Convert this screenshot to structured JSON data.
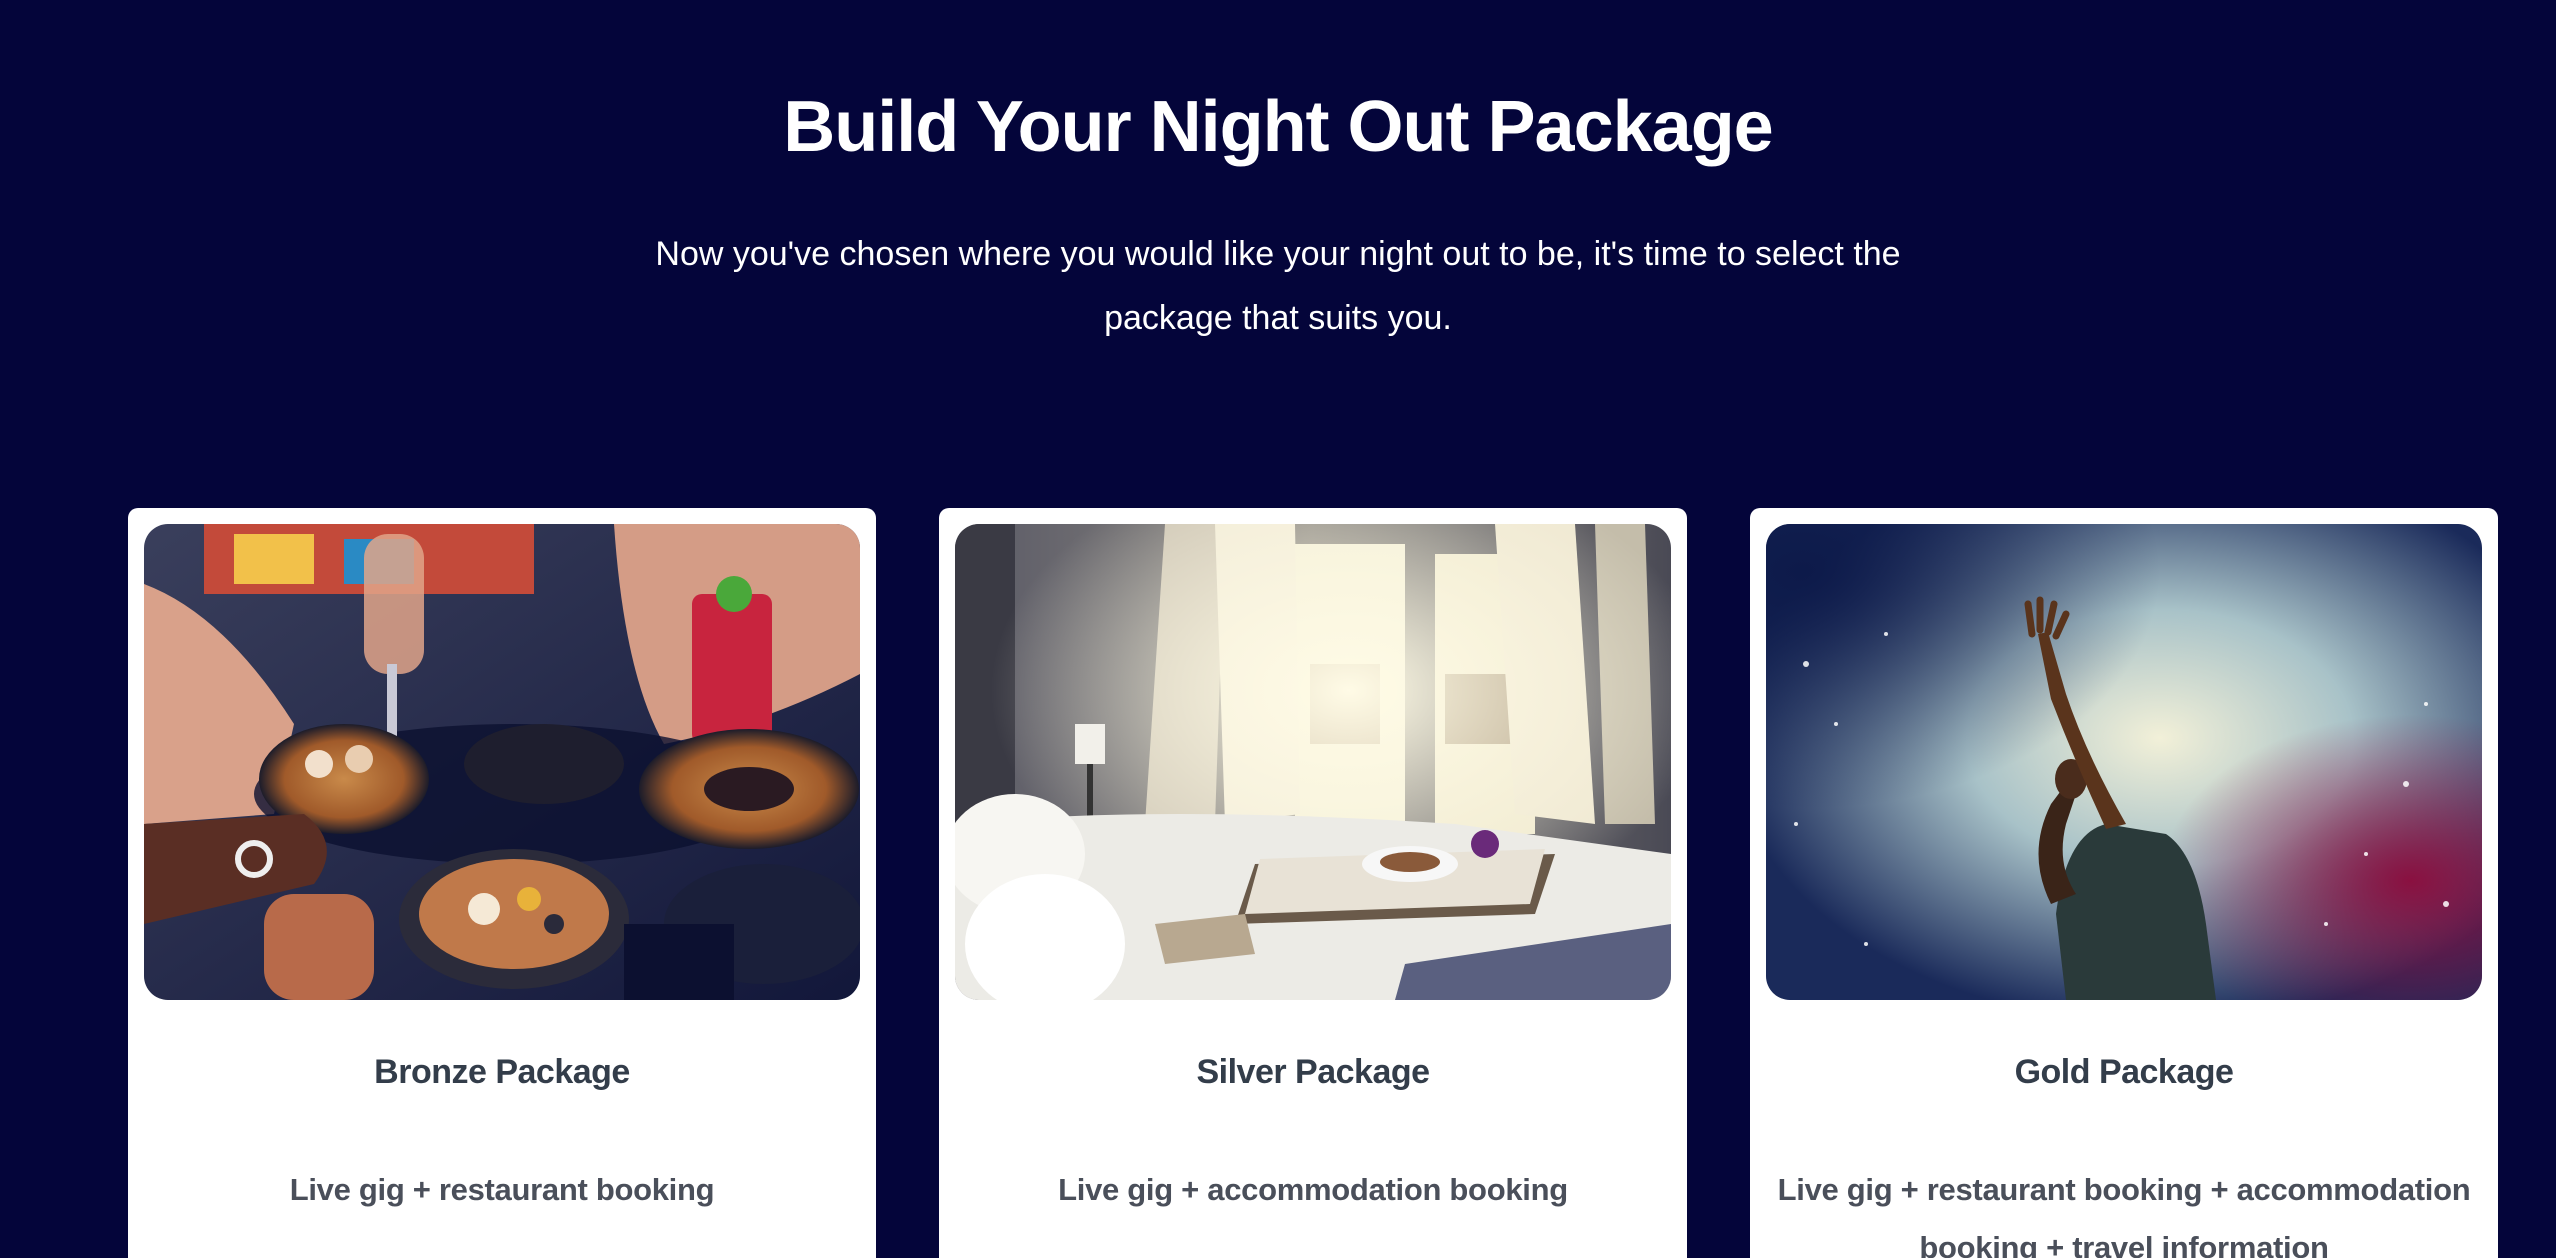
{
  "header": {
    "title": "Build Your Night Out Package",
    "subtitle": "Now you've chosen where you would like your night out to be, it's time to select the package that suits you."
  },
  "packages": [
    {
      "title": "Bronze Package",
      "description": "Live gig + restaurant booking",
      "image": "restaurant-dinner-table-photo"
    },
    {
      "title": "Silver Package",
      "description": "Live gig + accommodation booking",
      "image": "hotel-bedroom-breakfast-tray-photo"
    },
    {
      "title": "Gold Package",
      "description": "Live gig + restaurant booking + accommodation booking + travel information",
      "image": "concert-crowd-raised-hand-photo"
    }
  ],
  "colors": {
    "background": "#04053a",
    "card": "#ffffff",
    "card_title": "#333d4a",
    "card_text": "#4a4f5a"
  }
}
